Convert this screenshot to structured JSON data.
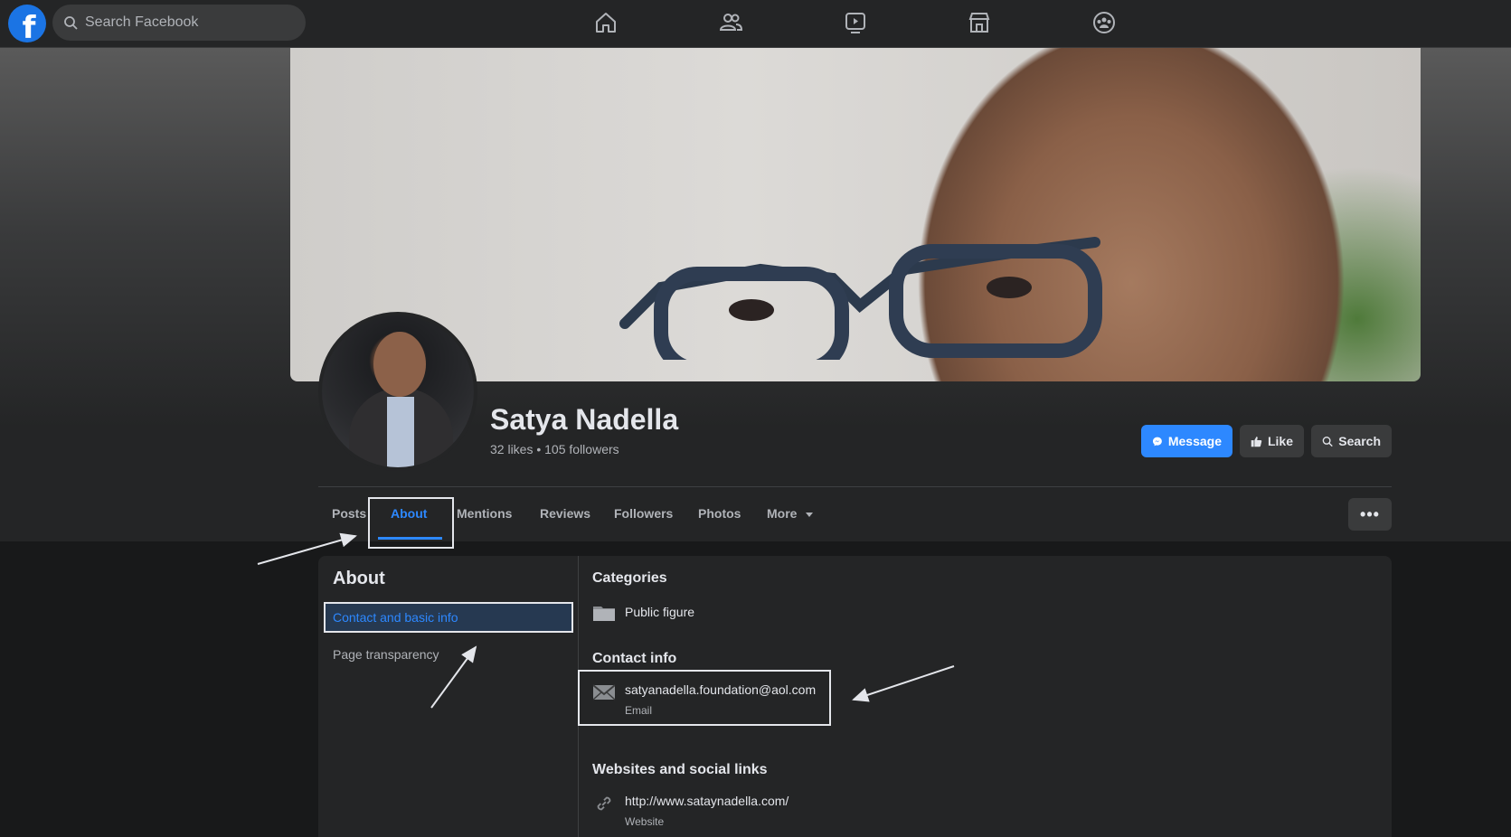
{
  "topbar": {
    "logo_letter": "f",
    "search_placeholder": "Search Facebook",
    "nav": [
      "home-icon",
      "friends-icon",
      "watch-icon",
      "marketplace-icon",
      "groups-icon"
    ]
  },
  "profile": {
    "name": "Satya Nadella",
    "stats": "32 likes • 105 followers"
  },
  "actions": {
    "message": "Message",
    "like": "Like",
    "search": "Search"
  },
  "tabs": [
    "Posts",
    "About",
    "Mentions",
    "Reviews",
    "Followers",
    "Photos",
    "More"
  ],
  "more_menu_glyph": "•••",
  "about": {
    "title": "About",
    "sidebar": [
      "Contact and basic info",
      "Page transparency"
    ],
    "categories_heading": "Categories",
    "category": "Public figure",
    "contact_heading": "Contact info",
    "email": "satyanadella.foundation@aol.com",
    "email_label": "Email",
    "websites_heading": "Websites and social links",
    "website": "http://www.sataynadella.com/",
    "website_label": "Website"
  },
  "colors": {
    "accent": "#2d88ff",
    "background": "#18191a",
    "surface": "#242526"
  }
}
